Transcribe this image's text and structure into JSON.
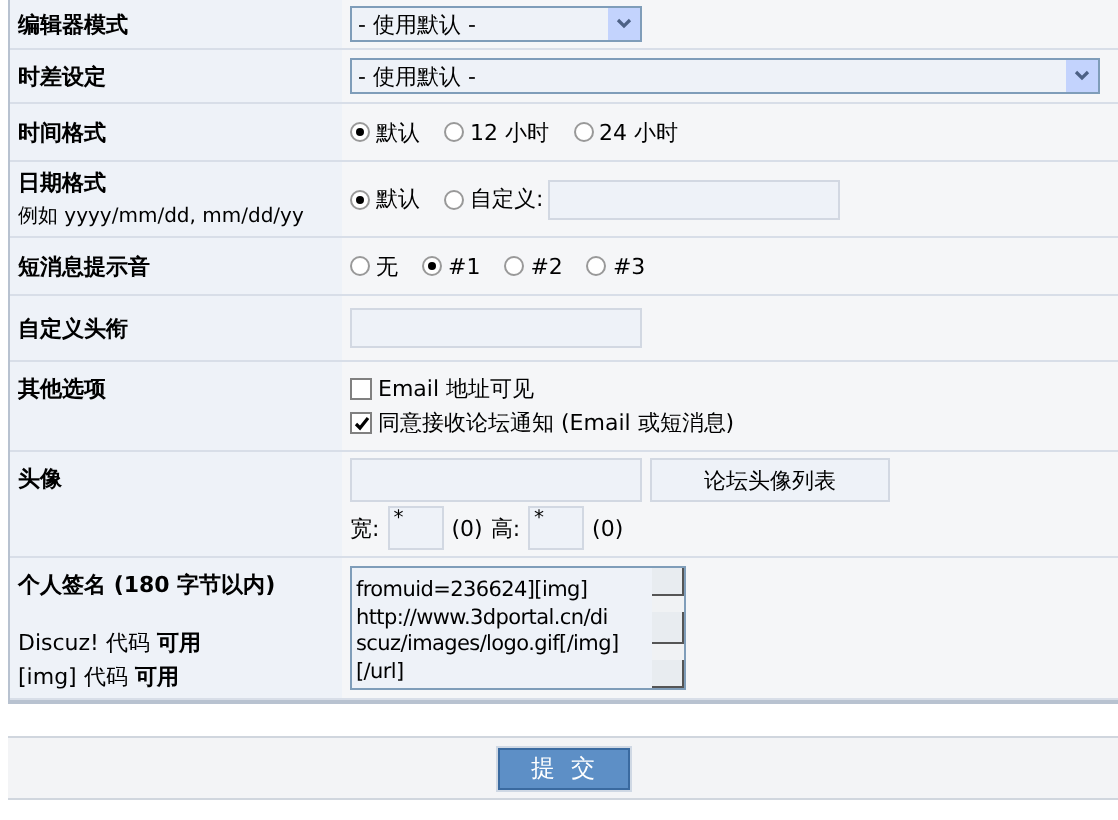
{
  "rows": [
    {
      "kind": "select",
      "label": "编辑器模式",
      "value": "- 使用默认 -",
      "wide": false
    },
    {
      "kind": "select",
      "label": "时差设定",
      "value": "- 使用默认 -",
      "wide": true
    },
    {
      "kind": "radio",
      "label": "时间格式",
      "options": [
        {
          "label": "默认",
          "selected": true
        },
        {
          "label": "12 小时",
          "selected": false
        },
        {
          "label": "24 小时",
          "selected": false
        }
      ]
    },
    {
      "kind": "date",
      "label": "日期格式",
      "hint": "例如  yyyy/mm/dd, mm/dd/yy",
      "options": [
        {
          "label": "默认",
          "selected": true
        },
        {
          "label": "自定义:",
          "selected": false
        }
      ]
    },
    {
      "kind": "radio",
      "label": "短消息提示音",
      "options": [
        {
          "label": "无",
          "selected": false
        },
        {
          "label": "#1",
          "selected": true
        },
        {
          "label": "#2",
          "selected": false
        },
        {
          "label": "#3",
          "selected": false
        }
      ]
    },
    {
      "kind": "text",
      "label": "自定义头衔"
    },
    {
      "kind": "checkbox",
      "label": "其他选项",
      "options": [
        {
          "label": "Email 地址可见",
          "checked": false
        },
        {
          "label": "同意接收论坛通知 (Email 或短消息)",
          "checked": true
        }
      ]
    },
    {
      "kind": "avatar",
      "label": "头像",
      "button": "论坛头像列表",
      "width_label": "宽:",
      "width_value": "*",
      "width_note": "(0)",
      "height_label": "高:",
      "height_value": "*",
      "height_note": "(0)"
    },
    {
      "kind": "signature",
      "label": "个人签名 (180 字节以内)",
      "notes": [
        "Discuz! 代码 **可用**",
        "[img] 代码 **可用**"
      ],
      "lines": [
        "fromuid=236624][img]",
        "http://www.3dportal.cn/di",
        "scuz/images/logo.gif[/img]",
        "[/url]"
      ]
    }
  ],
  "submit": "提  交"
}
